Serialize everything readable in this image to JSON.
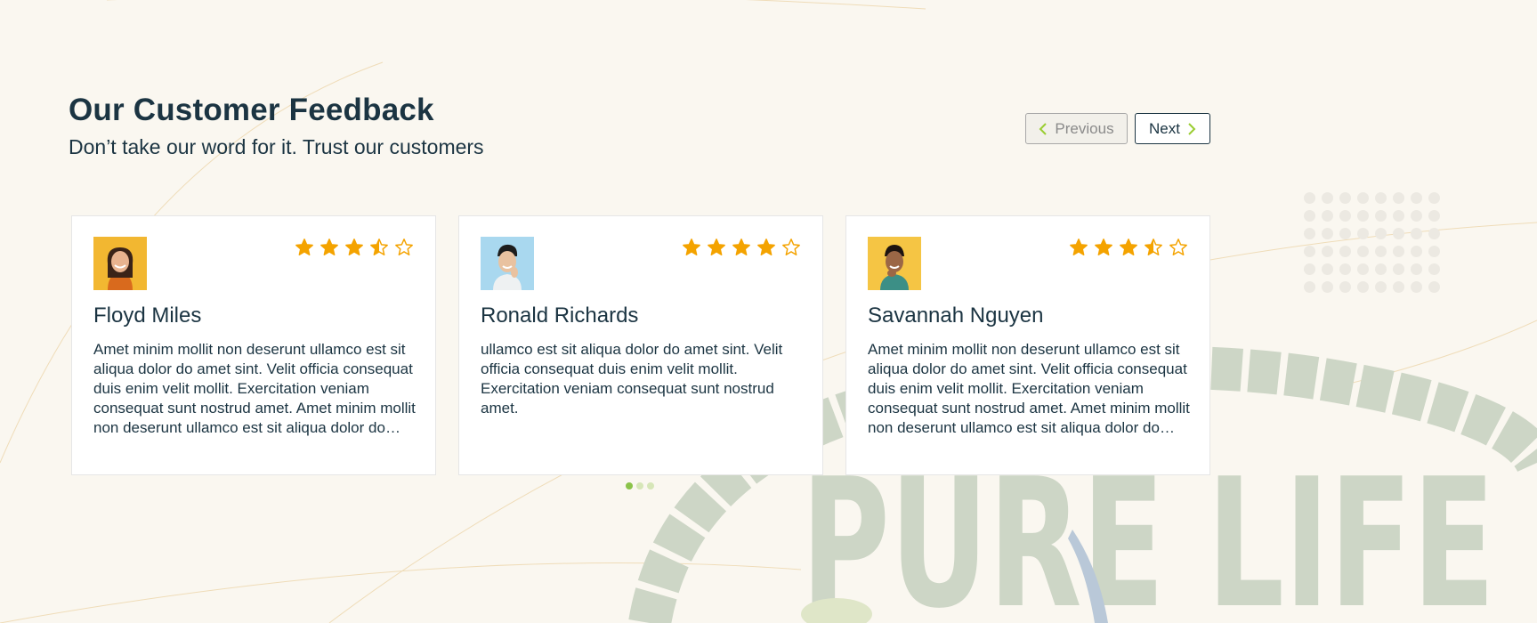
{
  "section": {
    "title": "Our Customer Feedback",
    "subtitle": "Don’t take our word for it. Trust our customers"
  },
  "nav": {
    "previous_label": "Previous",
    "next_label": "Next"
  },
  "testimonials": [
    {
      "name": "Floyd Miles",
      "rating": 3.5,
      "text": "Amet minim mollit non deserunt ullamco est sit aliqua dolor do amet sint. Velit officia consequat duis enim velit mollit. Exercitation veniam consequat sunt nostrud amet. Amet minim mollit non deserunt ullamco est sit aliqua dolor do amet sint.",
      "avatar_bg": "#f2b731"
    },
    {
      "name": "Ronald Richards",
      "rating": 4,
      "text": "ullamco est sit aliqua dolor do amet sint. Velit officia consequat duis enim velit mollit. Exercitation veniam consequat sunt nostrud amet.",
      "avatar_bg": "#a9d8ef"
    },
    {
      "name": "Savannah Nguyen",
      "rating": 3.5,
      "text": "Amet minim mollit non deserunt ullamco est sit aliqua dolor do amet sint. Velit officia consequat duis enim velit mollit. Exercitation veniam consequat sunt nostrud amet. Amet minim mollit non deserunt ullamco est sit aliqua dolor do amet sint.",
      "avatar_bg": "#f5c544"
    }
  ],
  "pagination": {
    "count": 3,
    "active": 0
  },
  "background": {
    "watermark_text": "PURE LIFE"
  },
  "colors": {
    "star": "#f4a300",
    "accent": "#9acd32",
    "heading": "#1b3442",
    "watermark": "#cdd6c6"
  }
}
